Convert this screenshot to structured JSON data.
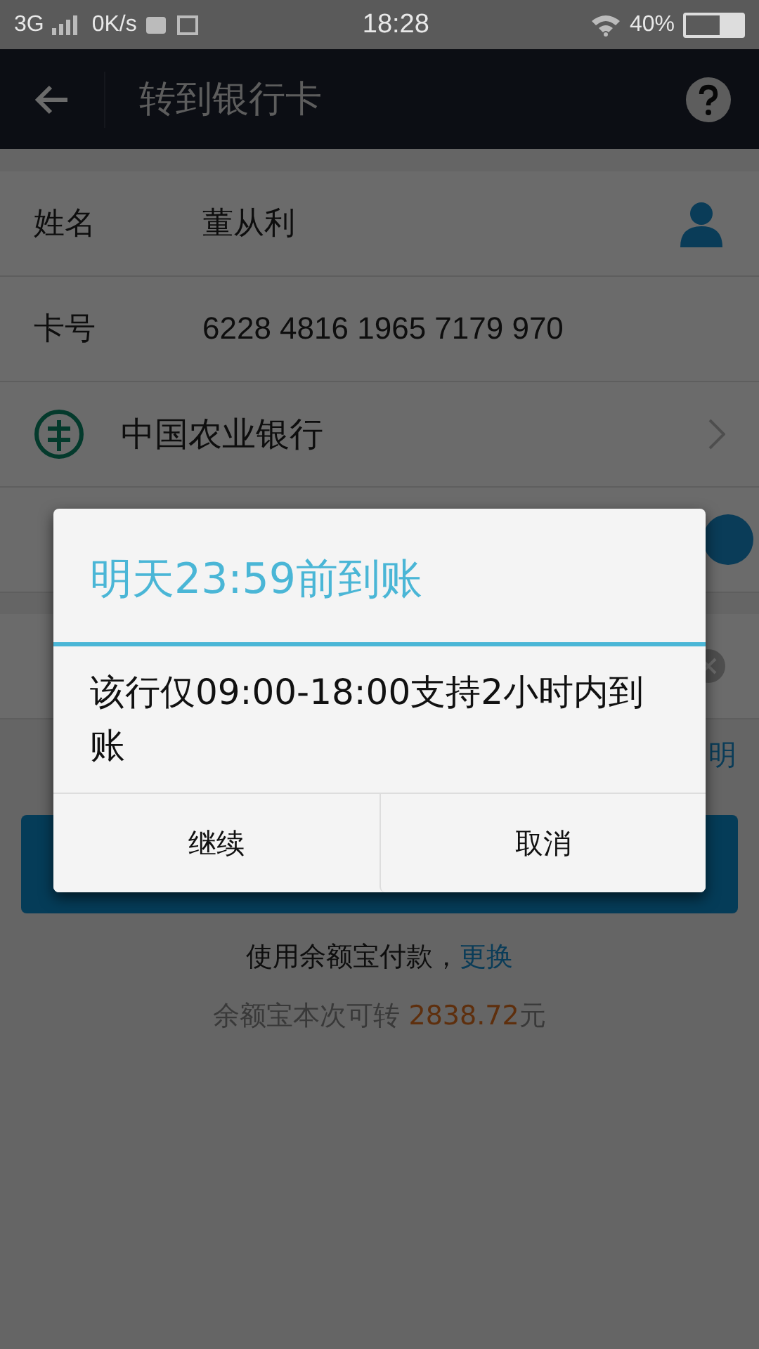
{
  "status_bar": {
    "network": "3G",
    "speed": "0K/s",
    "time": "18:28",
    "battery": "40%"
  },
  "header": {
    "title": "转到银行卡"
  },
  "form": {
    "rows": [
      {
        "kind": "contact",
        "label": "姓名",
        "value": "董从利"
      },
      {
        "kind": "text",
        "label": "卡号",
        "value": "6228 4816 1965 7179 970"
      },
      {
        "kind": "bank",
        "value": "中国农业银行"
      },
      {
        "kind": "toggle"
      },
      {
        "kind": "amount"
      }
    ],
    "note_link": "明"
  },
  "payment": {
    "text": "使用余额宝付款，",
    "link": "更换",
    "limit_text": "余额宝本次可转",
    "limit_amount": "2838.72",
    "limit_unit": "元"
  },
  "dialog": {
    "title": "明天23:59前到账",
    "message": "该行仅09:00-18:00支持2小时内到账",
    "buttons": [
      "继续",
      "取消"
    ]
  }
}
